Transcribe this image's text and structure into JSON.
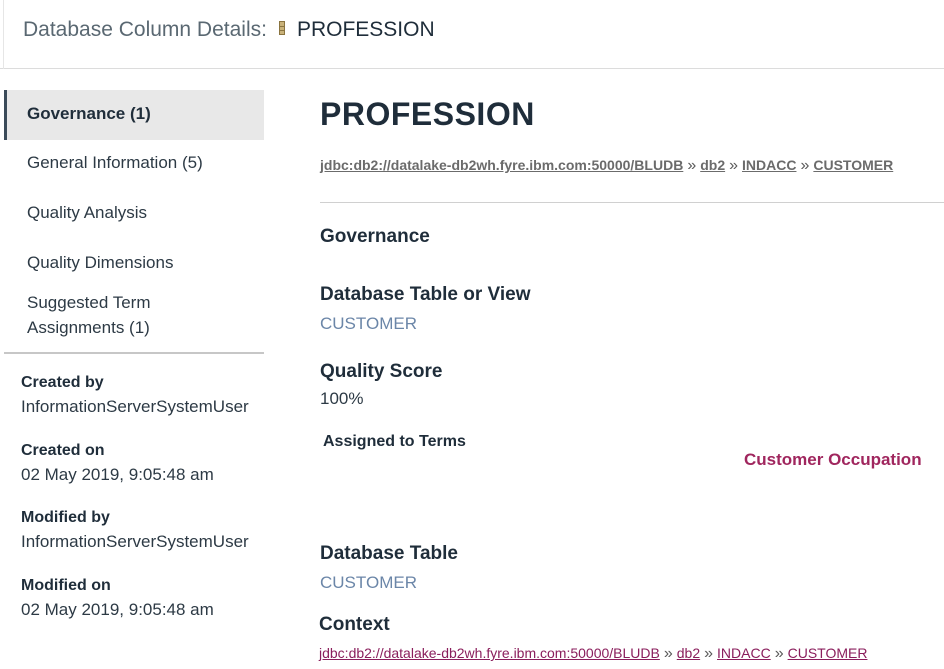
{
  "header": {
    "title_prefix": "Database Column Details:",
    "column_name": "PROFESSION",
    "icon": "database-column-icon"
  },
  "sidebar": {
    "nav": [
      {
        "label": "Governance (1)",
        "active": true
      },
      {
        "label": "General Information (5)",
        "active": false
      },
      {
        "label": "Quality Analysis",
        "active": false
      },
      {
        "label": "Quality Dimensions",
        "active": false
      },
      {
        "label": "Suggested Term Assignments (1)",
        "active": false
      }
    ],
    "meta": {
      "created_by_label": "Created by",
      "created_by": "InformationServerSystemUser",
      "created_on_label": "Created on",
      "created_on": "02 May 2019, 9:05:48 am",
      "modified_by_label": "Modified by",
      "modified_by": "InformationServerSystemUser",
      "modified_on_label": "Modified on",
      "modified_on": "02 May 2019, 9:05:48 am"
    }
  },
  "main": {
    "title": "PROFESSION",
    "breadcrumb": [
      "jdbc:db2://datalake-db2wh.fyre.ibm.com:50000/BLUDB",
      "db2",
      "INDACC",
      "CUSTOMER"
    ],
    "breadcrumb_separator": "»",
    "governance_title": "Governance",
    "table_or_view_label": "Database Table or View",
    "table_or_view_value": "CUSTOMER",
    "quality_score_label": "Quality Score",
    "quality_score_value": "100%",
    "assigned_terms_label": "Assigned to Terms",
    "assigned_terms": [
      "Customer Occupation"
    ],
    "database_table_label": "Database Table",
    "database_table_value": "CUSTOMER",
    "context_label": "Context",
    "context_path": [
      "jdbc:db2://datalake-db2wh.fyre.ibm.com:50000/BLUDB",
      "db2",
      "INDACC",
      "CUSTOMER"
    ]
  },
  "colors": {
    "term_link": "#a0265e",
    "context_link": "#8a1e5c",
    "value_blue": "#6b86a8",
    "active_nav_bg": "#e8e8e8"
  }
}
